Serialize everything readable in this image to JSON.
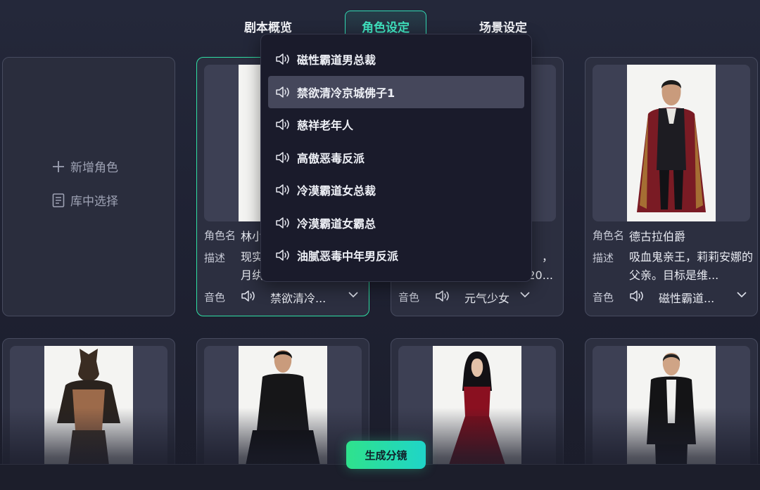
{
  "tabs": [
    {
      "label": "剧本概览"
    },
    {
      "label": "角色设定"
    },
    {
      "label": "场景设定"
    }
  ],
  "add_card": {
    "new_role": "新增角色",
    "from_library": "库中选择"
  },
  "labels": {
    "name": "角色名",
    "desc": "描述",
    "voice": "音色"
  },
  "cards": [
    {
      "name": "林小",
      "desc": "现实\n月纨",
      "voice": "禁欲清冷..."
    },
    {
      "name": "",
      "desc": "，\n20...",
      "voice": "元气少女"
    },
    {
      "name": "德古拉伯爵",
      "desc": "吸血鬼亲王，莉莉安娜的父亲。目标是维...",
      "voice": "磁性霸道..."
    }
  ],
  "dropdown": {
    "items": [
      {
        "label": "磁性霸道男总裁"
      },
      {
        "label": "禁欲清冷京城佛子1"
      },
      {
        "label": "慈祥老年人"
      },
      {
        "label": "高傲恶毒反派"
      },
      {
        "label": "冷漠霸道女总裁"
      },
      {
        "label": "冷漠霸道女霸总"
      },
      {
        "label": "油腻恶毒中年男反派"
      }
    ],
    "selected_index": 1
  },
  "footer": {
    "generate_label": "生成分镜"
  },
  "colors": {
    "accent": "#2fe0a4",
    "tab_active": "#32d9b4"
  }
}
